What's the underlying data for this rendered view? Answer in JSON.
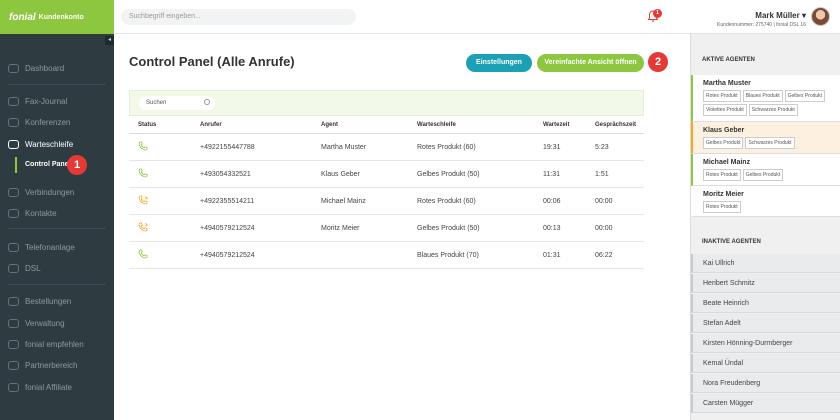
{
  "brand": {
    "logo": "fonial",
    "sub": "Kundenkonto"
  },
  "search": {
    "placeholder": "Suchbegriff eingeben..."
  },
  "notifications": {
    "count": "1"
  },
  "user": {
    "name": "Mark Müller",
    "meta": "Kundennummer: 275740 | fonial DSL 16"
  },
  "sidebar": {
    "items": [
      {
        "label": "Dashboard",
        "icon": "speedometer-icon"
      },
      {
        "label": "Fax-Journal",
        "icon": "fax-icon"
      },
      {
        "label": "Konferenzen",
        "icon": "conference-icon"
      },
      {
        "label": "Warteschleife",
        "icon": "queue-icon"
      },
      {
        "label": "Control Panel"
      },
      {
        "label": "Verbindungen",
        "icon": "connections-icon"
      },
      {
        "label": "Kontakte",
        "icon": "contacts-icon"
      },
      {
        "label": "Telefonanlage",
        "icon": "pbx-icon"
      },
      {
        "label": "DSL",
        "icon": "wifi-icon"
      },
      {
        "label": "Bestellungen",
        "icon": "cart-icon"
      },
      {
        "label": "Verwaltung",
        "icon": "gear-icon"
      },
      {
        "label": "fonial empfehlen",
        "icon": "recommend-icon"
      },
      {
        "label": "Partnerbereich",
        "icon": "partner-icon"
      },
      {
        "label": "fonial Affiliate",
        "icon": "affiliate-icon"
      }
    ]
  },
  "steps": {
    "one": "1",
    "two": "2"
  },
  "main": {
    "title": "Control Panel (Alle Anrufe)",
    "settings_label": "Einstellungen",
    "simple_view_label": "Vereinfachte Ansicht öffnen",
    "table_search_placeholder": "Suchen"
  },
  "table": {
    "headers": [
      "Status",
      "Anrufer",
      "Agent",
      "Warteschleife",
      "Wartezeit",
      "Gesprächszeit"
    ],
    "rows": [
      {
        "status": "active",
        "caller": "+4922155447788",
        "agent": "Martha Muster",
        "queue": "Rotes Produkt (60)",
        "wait": "19:31",
        "talk": "5:23"
      },
      {
        "status": "active",
        "caller": "+493054332521",
        "agent": "Klaus Geber",
        "queue": "Gelbes Produkt (50)",
        "wait": "11:31",
        "talk": "1:51"
      },
      {
        "status": "ringing",
        "caller": "+4922355514211",
        "agent": "Michael Mainz",
        "queue": "Rotes Produkt (60)",
        "wait": "00:06",
        "talk": "00:00"
      },
      {
        "status": "ringing",
        "caller": "+4940579212524",
        "agent": "Moritz Meier",
        "queue": "Gelbes Produkt (50)",
        "wait": "00:13",
        "talk": "00:00"
      },
      {
        "status": "waiting",
        "caller": "+4940579212524",
        "agent": "",
        "queue": "Blaues Produkt (70)",
        "wait": "01:31",
        "talk": "06:22"
      }
    ]
  },
  "right": {
    "active_heading": "AKTIVE AGENTEN",
    "inactive_heading": "INAKTIVE AGENTEN",
    "active_agents": [
      {
        "name": "Martha Muster",
        "state_color": "#8dc63f",
        "tags": [
          "Rotes Produkt",
          "Blaues Produkt",
          "Gelbes Produkt",
          "Violettes Produkt",
          "Schwarzes Produkt"
        ]
      },
      {
        "name": "Klaus Geber",
        "state_color": "#f5a623",
        "tags": [
          "Gelbes Produkt",
          "Schwarzes Produkt"
        ]
      },
      {
        "name": "Michael Mainz",
        "state_color": "#8dc63f",
        "tags": [
          "Rotes Produkt",
          "Gelbes Produkt"
        ]
      },
      {
        "name": "Moritz Meier",
        "state_color": "#ffffff",
        "tags": [
          "Rotes Produkt"
        ]
      }
    ],
    "inactive_agents": [
      "Kai Ullrich",
      "Heribert Schmitz",
      "Beate Heinrich",
      "Stefan Adelt",
      "Kirsten Hönning-Durmberger",
      "Kemal Ündal",
      "Nora Freudenberg",
      "Carsten Mügger"
    ]
  },
  "colors": {
    "brand_green": "#8dc63f",
    "teal": "#1ca0b5",
    "sidebar": "#2e3c41",
    "badge_red": "#e53935"
  }
}
